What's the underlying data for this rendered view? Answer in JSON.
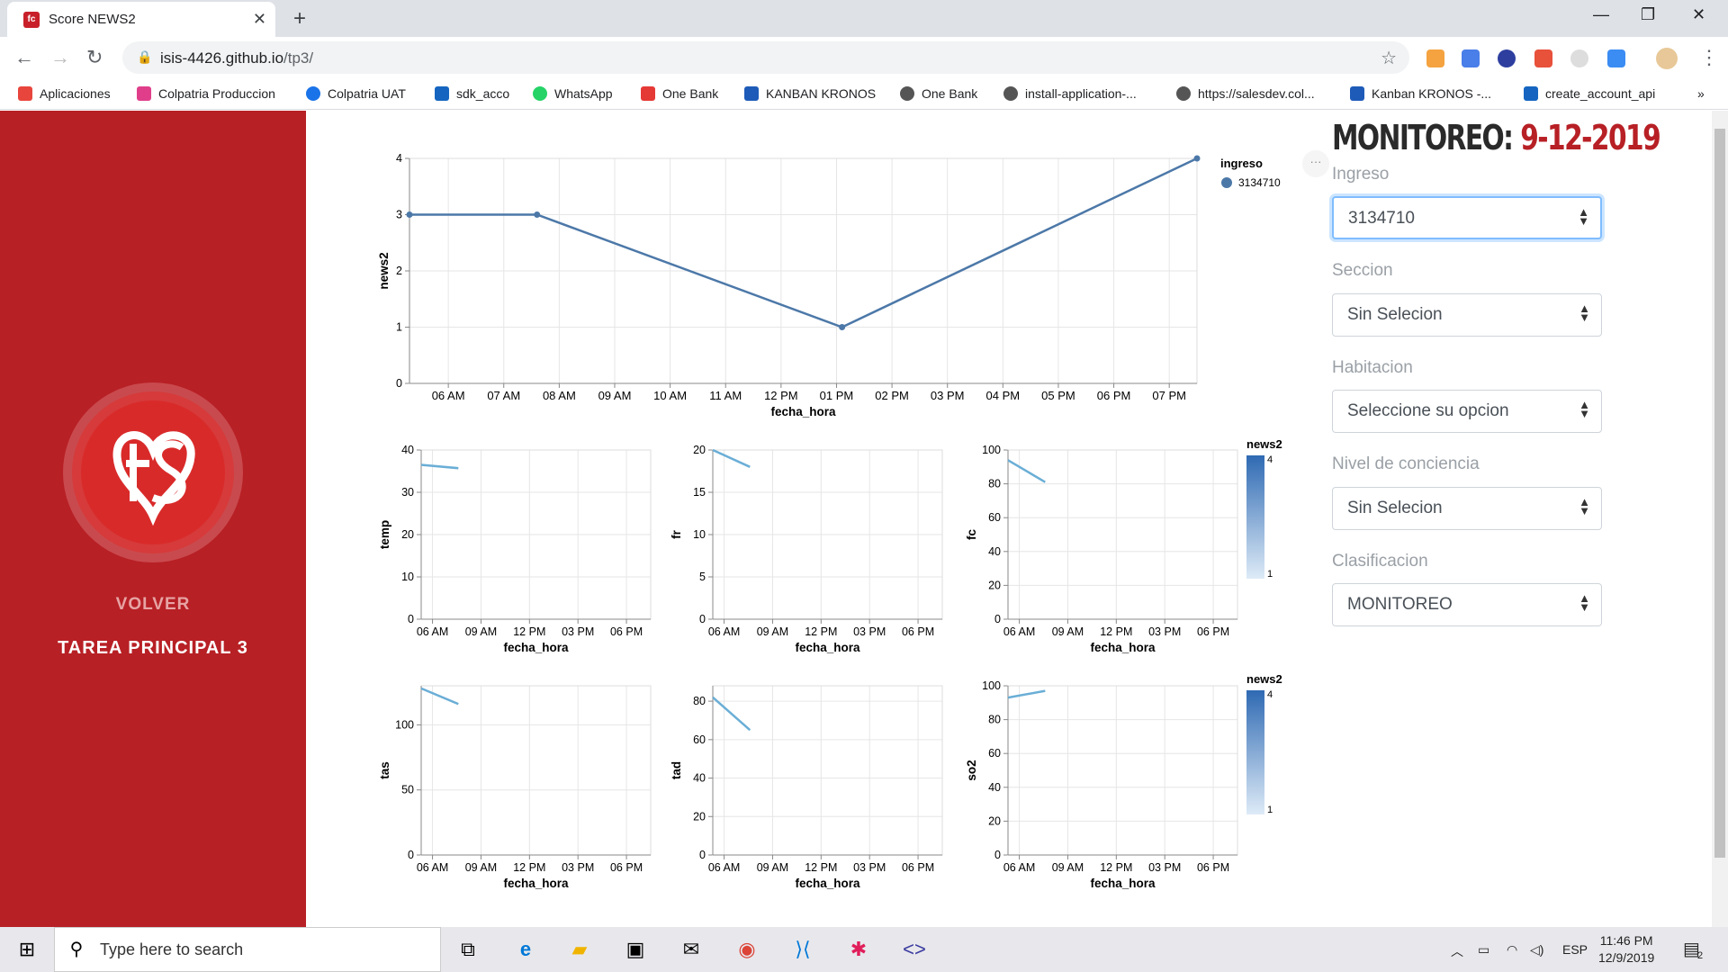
{
  "browser": {
    "tab_title": "Score NEWS2",
    "url_host": "isis-4426.github.io",
    "url_path": "/tp3/",
    "bookmarks": [
      "Aplicaciones",
      "Colpatria Produccion",
      "Colpatria UAT",
      "sdk_acco",
      "WhatsApp",
      "One Bank",
      "KANBAN KRONOS",
      "One Bank",
      "install-application-...",
      "https://salesdev.col...",
      "Kanban KRONOS -...",
      "create_account_api"
    ]
  },
  "sidebar": {
    "volver": "VOLVER",
    "tarea": "TAREA PRINCIPAL 3"
  },
  "form": {
    "title_prefix": "MONITOREO:",
    "title_date": "9-12-2019",
    "fields": [
      {
        "label": "Ingreso",
        "value": "3134710"
      },
      {
        "label": "Seccion",
        "value": "Sin Selecion"
      },
      {
        "label": "Habitacion",
        "value": "Seleccione su opcion"
      },
      {
        "label": "Nivel de conciencia",
        "value": "Sin Selecion"
      },
      {
        "label": "Clasificacion",
        "value": "MONITOREO"
      }
    ]
  },
  "chart_data": [
    {
      "type": "line",
      "xlabel": "fecha_hora",
      "ylabel": "news2",
      "ylim": [
        0,
        4
      ],
      "x_ticks": [
        "06 AM",
        "07 AM",
        "08 AM",
        "09 AM",
        "10 AM",
        "11 AM",
        "12 PM",
        "01 PM",
        "02 PM",
        "03 PM",
        "04 PM",
        "05 PM",
        "06 PM",
        "07 PM"
      ],
      "y_ticks": [
        0,
        1,
        2,
        3,
        4
      ],
      "legend": {
        "title": "ingreso",
        "items": [
          "3134710"
        ],
        "position": "right"
      },
      "series": [
        {
          "name": "3134710",
          "x": [
            5.3,
            7.6,
            13.1,
            19.5
          ],
          "values": [
            3,
            3,
            1,
            4
          ]
        }
      ],
      "x_range": [
        5.3,
        19.5
      ],
      "color": "#4c78a8"
    },
    {
      "type": "line",
      "xlabel": "fecha_hora",
      "ylabel": "temp",
      "ylim": [
        0,
        40
      ],
      "y_ticks": [
        0,
        10,
        20,
        30,
        40
      ],
      "x_ticks": [
        "06 AM",
        "09 AM",
        "12 PM",
        "03 PM",
        "06 PM"
      ],
      "x_range": [
        5.3,
        19.5
      ],
      "series": [
        {
          "x": [
            5.3,
            7.6
          ],
          "values": [
            36.5,
            35.7
          ]
        }
      ]
    },
    {
      "type": "line",
      "xlabel": "fecha_hora",
      "ylabel": "fr",
      "ylim": [
        0,
        20
      ],
      "y_ticks": [
        0,
        5,
        10,
        15,
        20
      ],
      "x_ticks": [
        "06 AM",
        "09 AM",
        "12 PM",
        "03 PM",
        "06 PM"
      ],
      "x_range": [
        5.3,
        19.5
      ],
      "series": [
        {
          "x": [
            5.3,
            7.6
          ],
          "values": [
            20,
            18
          ]
        }
      ]
    },
    {
      "type": "line",
      "xlabel": "fecha_hora",
      "ylabel": "fc",
      "ylim": [
        0,
        100
      ],
      "y_ticks": [
        0,
        20,
        40,
        60,
        80,
        100
      ],
      "x_ticks": [
        "06 AM",
        "09 AM",
        "12 PM",
        "03 PM",
        "06 PM"
      ],
      "x_range": [
        5.3,
        19.5
      ],
      "series": [
        {
          "x": [
            5.3,
            7.6
          ],
          "values": [
            94,
            81
          ]
        }
      ]
    },
    {
      "type": "line",
      "xlabel": "fecha_hora",
      "ylabel": "tas",
      "ylim": [
        0,
        130
      ],
      "y_ticks": [
        0,
        50,
        100
      ],
      "x_ticks": [
        "06 AM",
        "09 AM",
        "12 PM",
        "03 PM",
        "06 PM"
      ],
      "x_range": [
        5.3,
        19.5
      ],
      "series": [
        {
          "x": [
            5.3,
            7.6
          ],
          "values": [
            128,
            116
          ]
        }
      ]
    },
    {
      "type": "line",
      "xlabel": "fecha_hora",
      "ylabel": "tad",
      "ylim": [
        0,
        88
      ],
      "y_ticks": [
        0,
        20,
        40,
        60,
        80
      ],
      "x_ticks": [
        "06 AM",
        "09 AM",
        "12 PM",
        "03 PM",
        "06 PM"
      ],
      "x_range": [
        5.3,
        19.5
      ],
      "series": [
        {
          "x": [
            5.3,
            7.6
          ],
          "values": [
            82,
            65
          ]
        }
      ]
    },
    {
      "type": "line",
      "xlabel": "fecha_hora",
      "ylabel": "so2",
      "ylim": [
        0,
        100
      ],
      "y_ticks": [
        0,
        20,
        40,
        60,
        80,
        100
      ],
      "x_ticks": [
        "06 AM",
        "09 AM",
        "12 PM",
        "03 PM",
        "06 PM"
      ],
      "x_range": [
        5.3,
        19.5
      ],
      "series": [
        {
          "x": [
            5.3,
            7.6
          ],
          "values": [
            93,
            97
          ]
        }
      ]
    }
  ],
  "color_legends": [
    {
      "title": "news2",
      "max": "4",
      "min": "1"
    },
    {
      "title": "news2",
      "max": "4",
      "min": "1"
    }
  ],
  "taskbar": {
    "search_placeholder": "Type here to search",
    "lang": "ESP",
    "time": "11:46 PM",
    "date": "12/9/2019",
    "notifications": "2"
  },
  "colors": {
    "sidebar": "#b72025",
    "line": "#4c78a8",
    "small_line": "#6aaed6"
  }
}
